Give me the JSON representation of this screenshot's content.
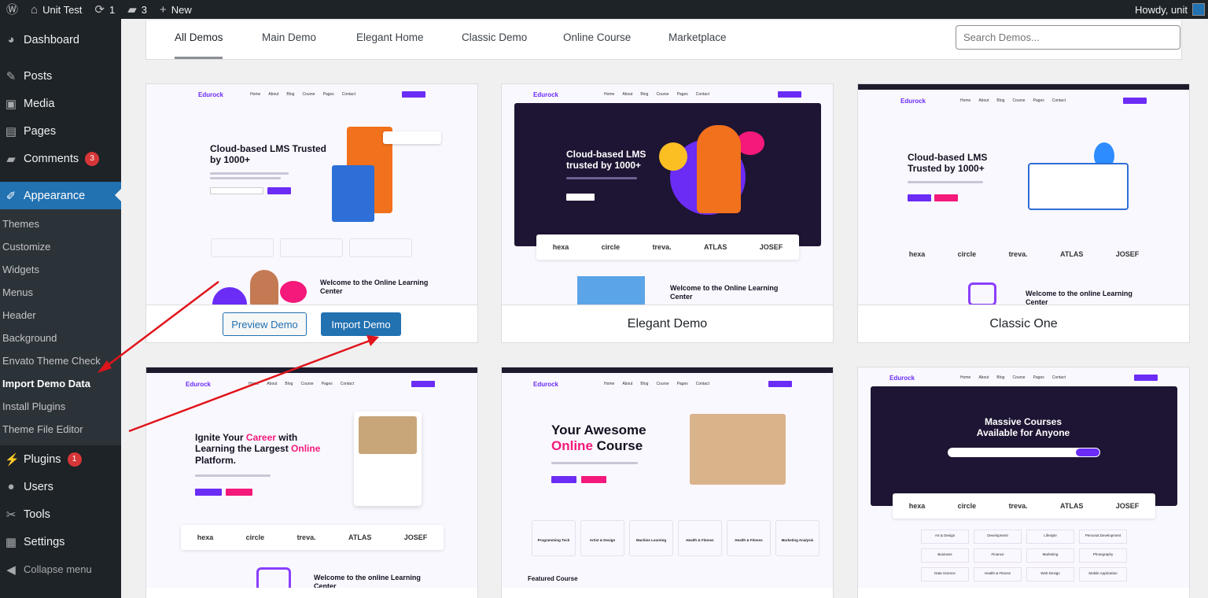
{
  "adminbar": {
    "site_name": "Unit Test",
    "updates_count": "1",
    "comments_count": "3",
    "new_label": "New",
    "howdy": "Howdy, unit"
  },
  "sidebar": {
    "items": [
      {
        "label": "Dashboard",
        "icon": "dashboard-icon"
      },
      {
        "label": "Posts",
        "icon": "pin-icon"
      },
      {
        "label": "Media",
        "icon": "media-icon"
      },
      {
        "label": "Pages",
        "icon": "pages-icon"
      },
      {
        "label": "Comments",
        "icon": "comment-icon",
        "badge": "3"
      },
      {
        "label": "Appearance",
        "icon": "brush-icon"
      },
      {
        "label": "Plugins",
        "icon": "plug-icon",
        "badge": "1"
      },
      {
        "label": "Users",
        "icon": "user-icon"
      },
      {
        "label": "Tools",
        "icon": "wrench-icon"
      },
      {
        "label": "Settings",
        "icon": "settings-icon"
      },
      {
        "label": "Collapse menu",
        "icon": "collapse-icon"
      }
    ],
    "appearance_submenu": [
      "Themes",
      "Customize",
      "Widgets",
      "Menus",
      "Header",
      "Background",
      "Envato Theme Check",
      "Import Demo Data",
      "Install Plugins",
      "Theme File Editor"
    ]
  },
  "filters": {
    "tabs": [
      "All Demos",
      "Main Demo",
      "Elegant Home",
      "Classic Demo",
      "Online Course",
      "Marketplace"
    ],
    "search_placeholder": "Search Demos..."
  },
  "cards": [
    {
      "hero": "Cloud-based LMS Trusted by 1000+",
      "welcome": "Welcome to the Online Learning Center",
      "preview": "Preview Demo",
      "import": "Import Demo"
    },
    {
      "hero": "Cloud-based LMS trusted by 1000+",
      "welcome": "Welcome to the Online Learning Center",
      "title": "Elegant Demo"
    },
    {
      "hero": "Cloud-based LMS Trusted by 1000+",
      "welcome": "Welcome to the online Learning Center",
      "title": "Classic One"
    },
    {
      "hero_a": "Ignite Your ",
      "hero_b": "Career",
      "hero_c": " with Learning the Largest ",
      "hero_d": "Online",
      "hero_e": " Platform.",
      "welcome": "Welcome to the online Learning Center"
    },
    {
      "hero_a": "Your Awesome",
      "hero_b": "Online",
      "hero_c": " Course",
      "featured": "Featured Course",
      "categories": [
        "Programming Tech",
        "Artist & Design",
        "Machine Learning",
        "Health & Fitness",
        "Health & Fitness",
        "Marketing Analysis"
      ]
    },
    {
      "hero_a": "Massive Courses",
      "hero_b": "Available for Anyone",
      "categories": [
        "Art & Design",
        "Development",
        "Lifestyle",
        "Personal Development",
        "Business",
        "Finance",
        "Marketing",
        "Photography",
        "Data Science",
        "Health & Fitness",
        "Web Design",
        "Mobile Application"
      ]
    }
  ],
  "brand": {
    "logo": "Edurock",
    "partners": [
      "hexa",
      "circle",
      "treva.",
      "ATLAS",
      "JOSEF"
    ]
  },
  "colors": {
    "wp_blue": "#2271b1",
    "sidebar_bg": "#1d2327",
    "accent_purple": "#6b2cf5",
    "accent_pink": "#f4197a",
    "arrow_red": "#e0141b"
  }
}
